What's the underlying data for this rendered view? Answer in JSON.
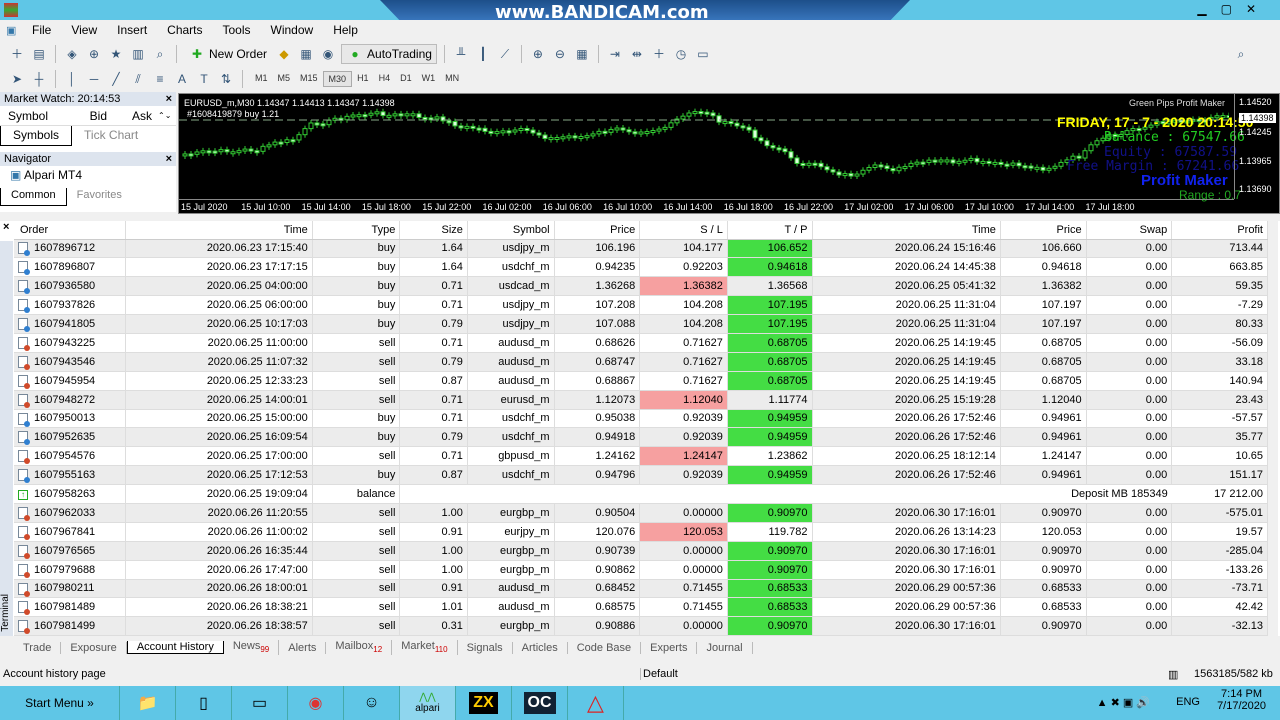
{
  "window": {
    "watermark": "www.BANDICAM.com"
  },
  "menu": [
    "File",
    "View",
    "Insert",
    "Charts",
    "Tools",
    "Window",
    "Help"
  ],
  "toolbar": {
    "new_order": "New Order",
    "autotrading": "AutoTrading",
    "timeframes": [
      "M1",
      "M5",
      "M15",
      "M30",
      "H1",
      "H4",
      "D1",
      "W1",
      "MN"
    ],
    "active_tf": "M30"
  },
  "market_watch": {
    "title": "Market Watch: 20:14:53",
    "cols": [
      "Symbol",
      "Bid",
      "Ask"
    ],
    "tabs": [
      "Symbols",
      "Tick Chart"
    ]
  },
  "navigator": {
    "title": "Navigator",
    "item": "Alpari MT4",
    "tabs": [
      "Common",
      "Favorites"
    ]
  },
  "chart": {
    "header": "EURUSD_m,M30  1.14347 1.14413 1.14347 1.14398",
    "order_line": "#1608419879 buy 1.21",
    "ea_name": "Green Pips Profit Maker",
    "date": "FRIDAY, 17 - 7 - 2020 20:14:50",
    "balance": "Balance   : 67547.66",
    "equity": "Equity    : 67587.59",
    "free_margin": "Free Margin  : 67241.66",
    "logo": "Profit Maker",
    "range": "Range : 0.7",
    "price_axis": [
      "1.14520",
      "1.14398",
      "1.14245",
      "1.13965",
      "1.13690"
    ],
    "time_axis": [
      "15 Jul 2020",
      "15 Jul 10:00",
      "15 Jul 14:00",
      "15 Jul 18:00",
      "15 Jul 22:00",
      "16 Jul 02:00",
      "16 Jul 06:00",
      "16 Jul 10:00",
      "16 Jul 14:00",
      "16 Jul 18:00",
      "16 Jul 22:00",
      "17 Jul 02:00",
      "17 Jul 06:00",
      "17 Jul 10:00",
      "17 Jul 14:00",
      "17 Jul 18:00"
    ]
  },
  "colors": {
    "buy": "#2f7fd0",
    "sell": "#d04a2a",
    "tp_hit": "#44dd44",
    "sl_hit": "#f6a0a0"
  },
  "history": {
    "columns": [
      "Order",
      "Time",
      "Type",
      "Size",
      "Symbol",
      "Price",
      "S / L",
      "T / P",
      "Time",
      "Price",
      "Swap",
      "Profit"
    ],
    "rows": [
      [
        "1607896712",
        "2020.06.23 17:15:40",
        "buy",
        "1.64",
        "usdjpy_m",
        "106.196",
        "104.177",
        "106.652",
        "2020.06.24 15:16:46",
        "106.660",
        "0.00",
        "713.44",
        "tp"
      ],
      [
        "1607896807",
        "2020.06.23 17:17:15",
        "buy",
        "1.64",
        "usdchf_m",
        "0.94235",
        "0.92203",
        "0.94618",
        "2020.06.24 14:45:38",
        "0.94618",
        "0.00",
        "663.85",
        "tp"
      ],
      [
        "1607936580",
        "2020.06.25 04:00:00",
        "buy",
        "0.71",
        "usdcad_m",
        "1.36268",
        "1.36382",
        "1.36568",
        "2020.06.25 05:41:32",
        "1.36382",
        "0.00",
        "59.35",
        "sl"
      ],
      [
        "1607937826",
        "2020.06.25 06:00:00",
        "buy",
        "0.71",
        "usdjpy_m",
        "107.208",
        "104.208",
        "107.195",
        "2020.06.25 11:31:04",
        "107.197",
        "0.00",
        "-7.29",
        "tp"
      ],
      [
        "1607941805",
        "2020.06.25 10:17:03",
        "buy",
        "0.79",
        "usdjpy_m",
        "107.088",
        "104.208",
        "107.195",
        "2020.06.25 11:31:04",
        "107.197",
        "0.00",
        "80.33",
        "tp"
      ],
      [
        "1607943225",
        "2020.06.25 11:00:00",
        "sell",
        "0.71",
        "audusd_m",
        "0.68626",
        "0.71627",
        "0.68705",
        "2020.06.25 14:19:45",
        "0.68705",
        "0.00",
        "-56.09",
        "tp"
      ],
      [
        "1607943546",
        "2020.06.25 11:07:32",
        "sell",
        "0.79",
        "audusd_m",
        "0.68747",
        "0.71627",
        "0.68705",
        "2020.06.25 14:19:45",
        "0.68705",
        "0.00",
        "33.18",
        "tp"
      ],
      [
        "1607945954",
        "2020.06.25 12:33:23",
        "sell",
        "0.87",
        "audusd_m",
        "0.68867",
        "0.71627",
        "0.68705",
        "2020.06.25 14:19:45",
        "0.68705",
        "0.00",
        "140.94",
        "tp"
      ],
      [
        "1607948272",
        "2020.06.25 14:00:01",
        "sell",
        "0.71",
        "eurusd_m",
        "1.12073",
        "1.12040",
        "1.11774",
        "2020.06.25 15:19:28",
        "1.12040",
        "0.00",
        "23.43",
        "sl"
      ],
      [
        "1607950013",
        "2020.06.25 15:00:00",
        "buy",
        "0.71",
        "usdchf_m",
        "0.95038",
        "0.92039",
        "0.94959",
        "2020.06.26 17:52:46",
        "0.94961",
        "0.00",
        "-57.57",
        "tp"
      ],
      [
        "1607952635",
        "2020.06.25 16:09:54",
        "buy",
        "0.79",
        "usdchf_m",
        "0.94918",
        "0.92039",
        "0.94959",
        "2020.06.26 17:52:46",
        "0.94961",
        "0.00",
        "35.77",
        "tp"
      ],
      [
        "1607954576",
        "2020.06.25 17:00:00",
        "sell",
        "0.71",
        "gbpusd_m",
        "1.24162",
        "1.24147",
        "1.23862",
        "2020.06.25 18:12:14",
        "1.24147",
        "0.00",
        "10.65",
        "sl"
      ],
      [
        "1607955163",
        "2020.06.25 17:12:53",
        "buy",
        "0.87",
        "usdchf_m",
        "0.94796",
        "0.92039",
        "0.94959",
        "2020.06.26 17:52:46",
        "0.94961",
        "0.00",
        "151.17",
        "tp"
      ],
      [
        "1607958263",
        "2020.06.25 19:09:04",
        "balance",
        "",
        "",
        "",
        "",
        "",
        "",
        "Deposit MB 185349",
        "",
        "17 212.00",
        "bal"
      ],
      [
        "1607962033",
        "2020.06.26 11:20:55",
        "sell",
        "1.00",
        "eurgbp_m",
        "0.90504",
        "0.00000",
        "0.90970",
        "2020.06.30 17:16:01",
        "0.90970",
        "0.00",
        "-575.01",
        "tp"
      ],
      [
        "1607967841",
        "2020.06.26 11:00:02",
        "sell",
        "0.91",
        "eurjpy_m",
        "120.076",
        "120.053",
        "119.782",
        "2020.06.26 13:14:23",
        "120.053",
        "0.00",
        "19.57",
        "sl"
      ],
      [
        "1607976565",
        "2020.06.26 16:35:44",
        "sell",
        "1.00",
        "eurgbp_m",
        "0.90739",
        "0.00000",
        "0.90970",
        "2020.06.30 17:16:01",
        "0.90970",
        "0.00",
        "-285.04",
        "tp"
      ],
      [
        "1607979688",
        "2020.06.26 17:47:00",
        "sell",
        "1.00",
        "eurgbp_m",
        "0.90862",
        "0.00000",
        "0.90970",
        "2020.06.30 17:16:01",
        "0.90970",
        "0.00",
        "-133.26",
        "tp"
      ],
      [
        "1607980211",
        "2020.06.26 18:00:01",
        "sell",
        "0.91",
        "audusd_m",
        "0.68452",
        "0.71455",
        "0.68533",
        "2020.06.29 00:57:36",
        "0.68533",
        "0.00",
        "-73.71",
        "tp"
      ],
      [
        "1607981489",
        "2020.06.26 18:38:21",
        "sell",
        "1.01",
        "audusd_m",
        "0.68575",
        "0.71455",
        "0.68533",
        "2020.06.29 00:57:36",
        "0.68533",
        "0.00",
        "42.42",
        "tp"
      ],
      [
        "1607981499",
        "2020.06.26 18:38:57",
        "sell",
        "0.31",
        "eurgbp_m",
        "0.90886",
        "0.00000",
        "0.90970",
        "2020.06.30 17:16:01",
        "0.90970",
        "0.00",
        "-32.13",
        "tp"
      ]
    ]
  },
  "terminal_tabs": [
    {
      "label": "Trade"
    },
    {
      "label": "Exposure"
    },
    {
      "label": "Account History",
      "active": true
    },
    {
      "label": "News",
      "badge": "99"
    },
    {
      "label": "Alerts"
    },
    {
      "label": "Mailbox",
      "badge": "12"
    },
    {
      "label": "Market",
      "badge": "110"
    },
    {
      "label": "Signals"
    },
    {
      "label": "Articles"
    },
    {
      "label": "Code Base"
    },
    {
      "label": "Experts"
    },
    {
      "label": "Journal"
    }
  ],
  "terminal_side_label": "Terminal",
  "status": {
    "text": "Account history page",
    "profile": "Default",
    "traffic": "1563185/582 kb"
  },
  "taskbar": {
    "start": "Start Menu",
    "apps": [
      "file-explorer",
      "notepad",
      "window",
      "chrome",
      "user-app",
      "alpari",
      "zx-app",
      "oc-app",
      "triangle-app"
    ],
    "alpari_label": "alpari",
    "lang": "ENG",
    "time": "7:14 PM",
    "date": "7/17/2020"
  }
}
